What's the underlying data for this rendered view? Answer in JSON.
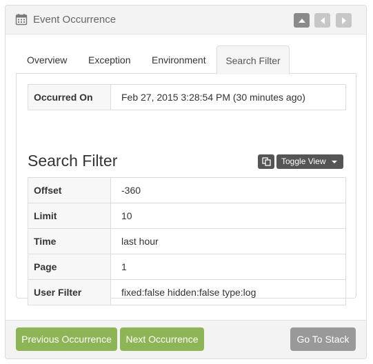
{
  "header": {
    "title": "Event Occurrence",
    "icon": "calendar-icon",
    "nav": [
      {
        "icon": "chevron-up-icon"
      },
      {
        "icon": "chevron-left-icon"
      },
      {
        "icon": "chevron-right-icon"
      }
    ]
  },
  "tabs": [
    {
      "label": "Overview",
      "active": false
    },
    {
      "label": "Exception",
      "active": false
    },
    {
      "label": "Environment",
      "active": false
    },
    {
      "label": "Search Filter",
      "active": true
    }
  ],
  "occurred": {
    "label": "Occurred On",
    "value": "Feb 27, 2015 3:28:54 PM (30 minutes ago)"
  },
  "section": {
    "title": "Search Filter",
    "copy_icon": "copy-icon",
    "toggle_label": "Toggle View"
  },
  "filter_rows": [
    {
      "key": "Offset",
      "value": "-360"
    },
    {
      "key": "Limit",
      "value": "10"
    },
    {
      "key": "Time",
      "value": "last hour"
    },
    {
      "key": "Page",
      "value": "1"
    },
    {
      "key": "User Filter",
      "value": "fixed:false hidden:false type:log"
    }
  ],
  "footer": {
    "previous_label": "Previous Occurrence",
    "next_label": "Next Occurrence",
    "stack_label": "Go To Stack"
  },
  "colors": {
    "accent_green": "#8db556",
    "button_gray": "#999999",
    "dark_button": "#555555"
  }
}
